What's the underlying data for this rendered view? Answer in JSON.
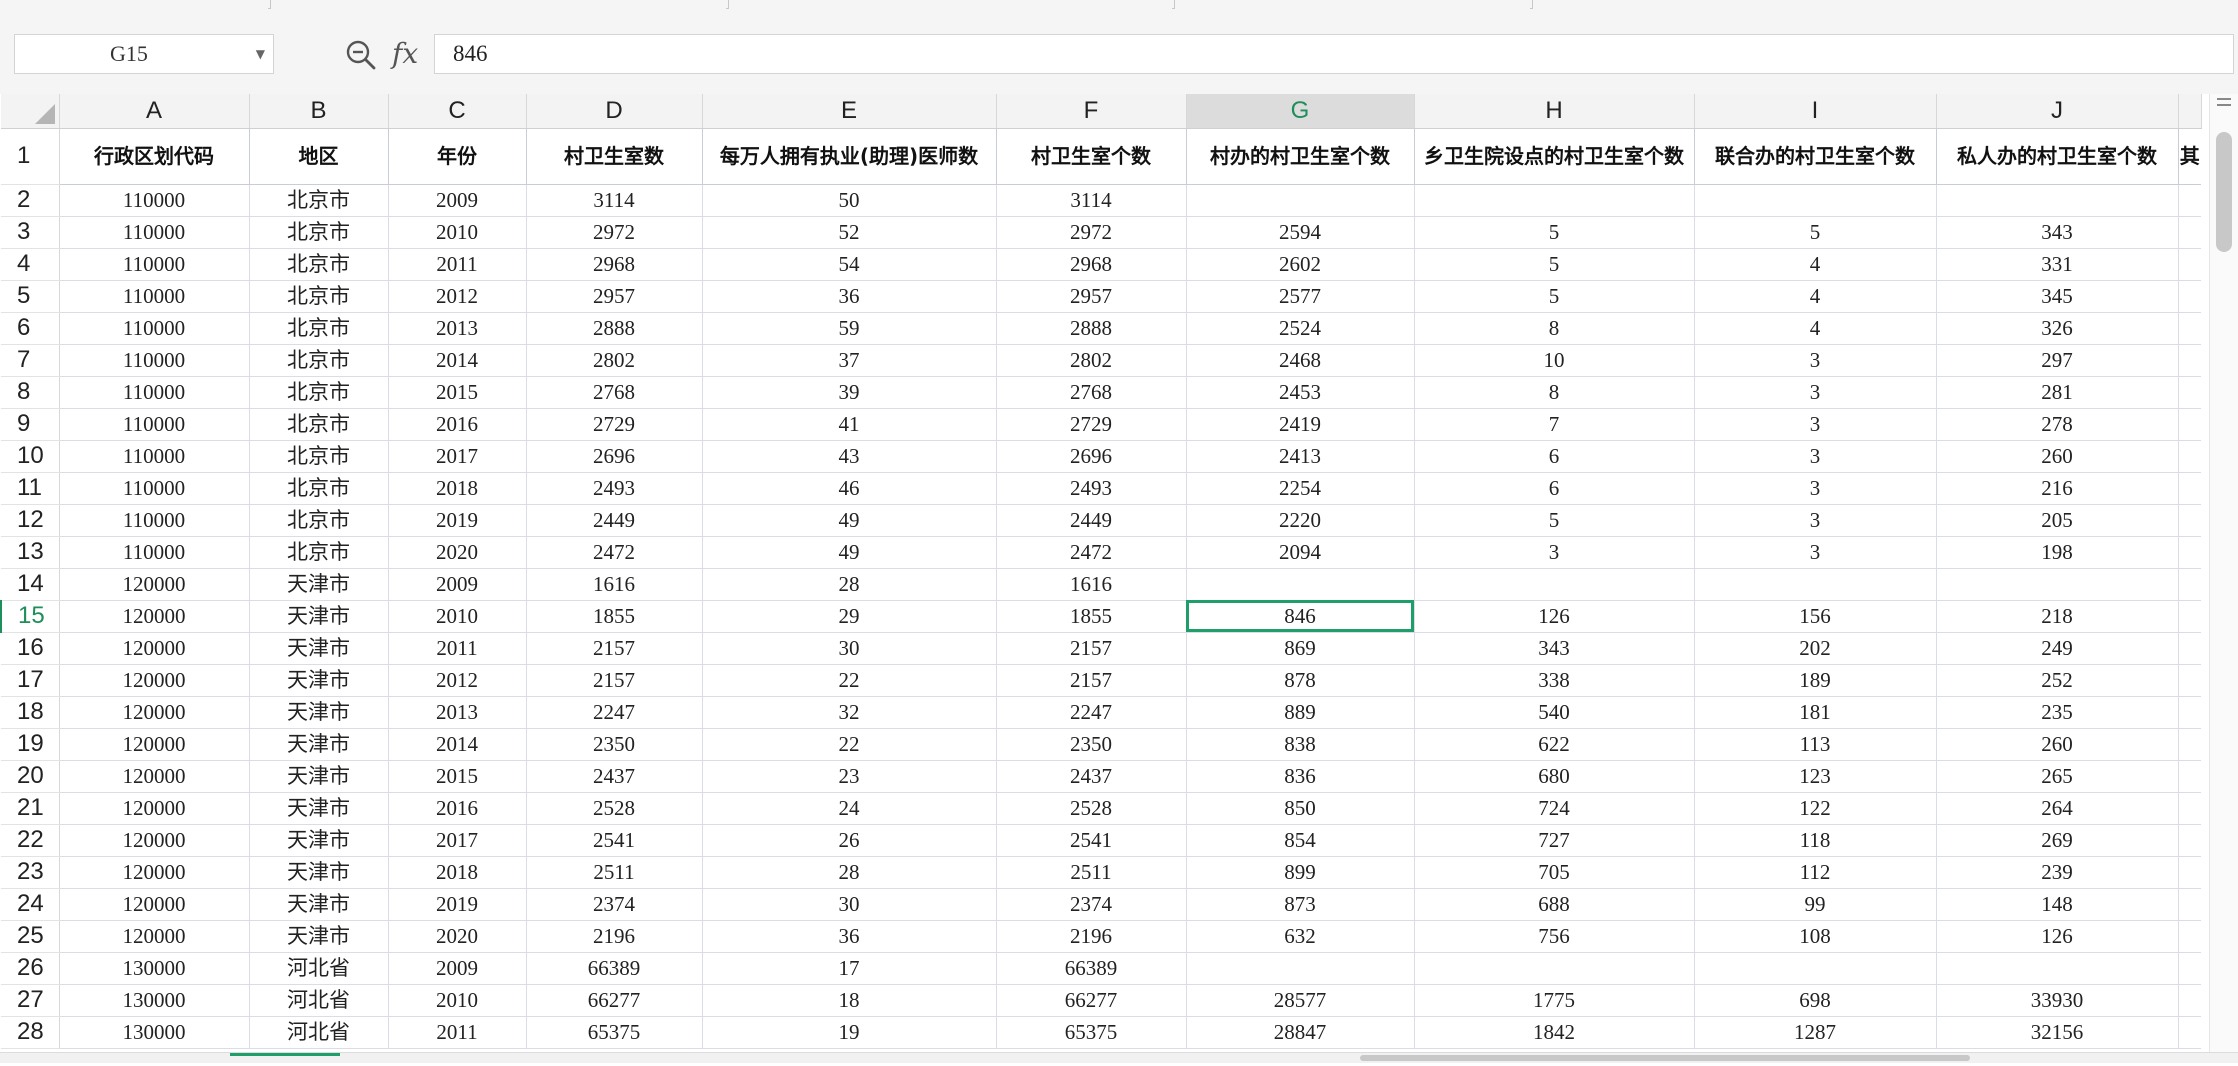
{
  "namebox": {
    "value": "G15"
  },
  "formula": {
    "value": "846"
  },
  "columns": [
    "A",
    "B",
    "C",
    "D",
    "E",
    "F",
    "G",
    "H",
    "I",
    "J"
  ],
  "selected_column": "G",
  "selected_row": 15,
  "header_row": [
    "行政区划代码",
    "地区",
    "年份",
    "村卫生室数",
    "每万人拥有执业(助理)医师数",
    "村卫生室个数",
    "村办的村卫生室个数",
    "乡卫生院设点的村卫生室个数",
    "联合办的村卫生室个数",
    "私人办的村卫生室个数"
  ],
  "partial_header": "其",
  "rows": [
    [
      2,
      "110000",
      "北京市",
      "2009",
      "3114",
      "50",
      "3114",
      "",
      "",
      "",
      ""
    ],
    [
      3,
      "110000",
      "北京市",
      "2010",
      "2972",
      "52",
      "2972",
      "2594",
      "5",
      "5",
      "343"
    ],
    [
      4,
      "110000",
      "北京市",
      "2011",
      "2968",
      "54",
      "2968",
      "2602",
      "5",
      "4",
      "331"
    ],
    [
      5,
      "110000",
      "北京市",
      "2012",
      "2957",
      "36",
      "2957",
      "2577",
      "5",
      "4",
      "345"
    ],
    [
      6,
      "110000",
      "北京市",
      "2013",
      "2888",
      "59",
      "2888",
      "2524",
      "8",
      "4",
      "326"
    ],
    [
      7,
      "110000",
      "北京市",
      "2014",
      "2802",
      "37",
      "2802",
      "2468",
      "10",
      "3",
      "297"
    ],
    [
      8,
      "110000",
      "北京市",
      "2015",
      "2768",
      "39",
      "2768",
      "2453",
      "8",
      "3",
      "281"
    ],
    [
      9,
      "110000",
      "北京市",
      "2016",
      "2729",
      "41",
      "2729",
      "2419",
      "7",
      "3",
      "278"
    ],
    [
      10,
      "110000",
      "北京市",
      "2017",
      "2696",
      "43",
      "2696",
      "2413",
      "6",
      "3",
      "260"
    ],
    [
      11,
      "110000",
      "北京市",
      "2018",
      "2493",
      "46",
      "2493",
      "2254",
      "6",
      "3",
      "216"
    ],
    [
      12,
      "110000",
      "北京市",
      "2019",
      "2449",
      "49",
      "2449",
      "2220",
      "5",
      "3",
      "205"
    ],
    [
      13,
      "110000",
      "北京市",
      "2020",
      "2472",
      "49",
      "2472",
      "2094",
      "3",
      "3",
      "198"
    ],
    [
      14,
      "120000",
      "天津市",
      "2009",
      "1616",
      "28",
      "1616",
      "",
      "",
      "",
      ""
    ],
    [
      15,
      "120000",
      "天津市",
      "2010",
      "1855",
      "29",
      "1855",
      "846",
      "126",
      "156",
      "218"
    ],
    [
      16,
      "120000",
      "天津市",
      "2011",
      "2157",
      "30",
      "2157",
      "869",
      "343",
      "202",
      "249"
    ],
    [
      17,
      "120000",
      "天津市",
      "2012",
      "2157",
      "22",
      "2157",
      "878",
      "338",
      "189",
      "252"
    ],
    [
      18,
      "120000",
      "天津市",
      "2013",
      "2247",
      "32",
      "2247",
      "889",
      "540",
      "181",
      "235"
    ],
    [
      19,
      "120000",
      "天津市",
      "2014",
      "2350",
      "22",
      "2350",
      "838",
      "622",
      "113",
      "260"
    ],
    [
      20,
      "120000",
      "天津市",
      "2015",
      "2437",
      "23",
      "2437",
      "836",
      "680",
      "123",
      "265"
    ],
    [
      21,
      "120000",
      "天津市",
      "2016",
      "2528",
      "24",
      "2528",
      "850",
      "724",
      "122",
      "264"
    ],
    [
      22,
      "120000",
      "天津市",
      "2017",
      "2541",
      "26",
      "2541",
      "854",
      "727",
      "118",
      "269"
    ],
    [
      23,
      "120000",
      "天津市",
      "2018",
      "2511",
      "28",
      "2511",
      "899",
      "705",
      "112",
      "239"
    ],
    [
      24,
      "120000",
      "天津市",
      "2019",
      "2374",
      "30",
      "2374",
      "873",
      "688",
      "99",
      "148"
    ],
    [
      25,
      "120000",
      "天津市",
      "2020",
      "2196",
      "36",
      "2196",
      "632",
      "756",
      "108",
      "126"
    ],
    [
      26,
      "130000",
      "河北省",
      "2009",
      "66389",
      "17",
      "66389",
      "",
      "",
      "",
      ""
    ],
    [
      27,
      "130000",
      "河北省",
      "2010",
      "66277",
      "18",
      "66277",
      "28577",
      "1775",
      "698",
      "33930"
    ],
    [
      28,
      "130000",
      "河北省",
      "2011",
      "65375",
      "19",
      "65375",
      "28847",
      "1842",
      "1287",
      "32156"
    ]
  ],
  "icons": {
    "zoom": "zoom-formula-icon",
    "fx": "fx-icon",
    "dropdown": "chevron-down-icon"
  }
}
